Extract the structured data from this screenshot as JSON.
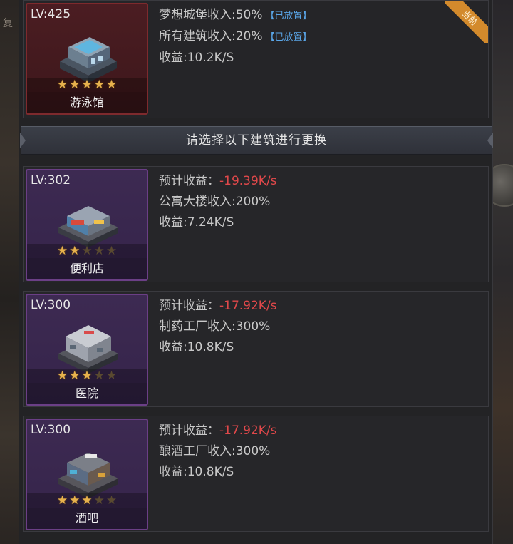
{
  "background": {
    "left_label": "复"
  },
  "current": {
    "level": "LV:425",
    "name": "游泳馆",
    "stars": [
      true,
      true,
      true,
      true,
      true
    ],
    "badge": "当前",
    "lines": [
      {
        "text": "梦想城堡收入:50%",
        "tag": "【已放置】"
      },
      {
        "text": "所有建筑收入:20%",
        "tag": "【已放置】"
      },
      {
        "text": "收益:10.2K/S"
      }
    ]
  },
  "header": {
    "title": "请选择以下建筑进行更换"
  },
  "options": [
    {
      "level": "LV:302",
      "name": "便利店",
      "stars": [
        true,
        true,
        false,
        false,
        false
      ],
      "forecast_label": "预计收益：",
      "forecast_value": "-19.39K/s",
      "bonus": "公寓大楼收入:200%",
      "income": "收益:7.24K/S"
    },
    {
      "level": "LV:300",
      "name": "医院",
      "stars": [
        true,
        true,
        true,
        false,
        false
      ],
      "forecast_label": "预计收益：",
      "forecast_value": "-17.92K/s",
      "bonus": "制药工厂收入:300%",
      "income": "收益:10.8K/S"
    },
    {
      "level": "LV:300",
      "name": "酒吧",
      "stars": [
        true,
        true,
        true,
        false,
        false
      ],
      "forecast_label": "预计收益：",
      "forecast_value": "-17.92K/s",
      "bonus": "酿酒工厂收入:300%",
      "income": "收益:10.8K/S"
    }
  ],
  "colors": {
    "negative": "#e0484a",
    "tag": "#5aa6e8",
    "star": "#e7b24d",
    "rare_frame": "#6b3f86",
    "current_frame": "#7e2a2d"
  }
}
